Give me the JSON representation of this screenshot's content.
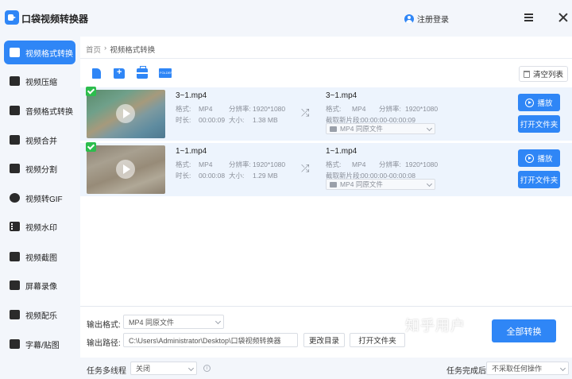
{
  "app": {
    "title": "口袋视频转换器",
    "login": "注册登录"
  },
  "sidebar": {
    "items": [
      {
        "label": "视频格式转换",
        "icon": "video-convert-icon",
        "active": true
      },
      {
        "label": "视频压缩",
        "icon": "video-compress-icon"
      },
      {
        "label": "音频格式转换",
        "icon": "audio-convert-icon"
      },
      {
        "label": "视频合并",
        "icon": "video-merge-icon"
      },
      {
        "label": "视频分割",
        "icon": "video-split-icon"
      },
      {
        "label": "视频转GIF",
        "icon": "gif-icon"
      },
      {
        "label": "视频水印",
        "icon": "watermark-icon"
      },
      {
        "label": "视频截图",
        "icon": "screenshot-icon"
      },
      {
        "label": "屏幕录像",
        "icon": "screen-record-icon"
      },
      {
        "label": "视频配乐",
        "icon": "music-icon"
      },
      {
        "label": "字幕/贴图",
        "icon": "subtitle-icon"
      }
    ]
  },
  "breadcrumb": {
    "home": "首页",
    "sep": "›",
    "current": "视频格式转换"
  },
  "toolbar": {
    "icons": [
      "add-file-icon",
      "add-folder-icon",
      "batch-icon",
      "folder-import-icon"
    ],
    "clear_label": "清空列表"
  },
  "labels": {
    "format": "格式:",
    "resolution": "分辨率:",
    "duration": "时长:",
    "size": "大小:",
    "clip": "截取新片段:",
    "play": "播放",
    "open_folder": "打开文件夹"
  },
  "files": [
    {
      "name": "3~1.mp4",
      "format": "MP4",
      "resolution": "1920*1080",
      "duration": "00:00:09",
      "size": "1.38 MB",
      "out_name": "3~1.mp4",
      "out_format": "MP4",
      "out_resolution": "1920*1080",
      "clip": "00:00:00-00:00:09",
      "out_select": "MP4  同原文件"
    },
    {
      "name": "1~1.mp4",
      "format": "MP4",
      "resolution": "1920*1080",
      "duration": "00:00:08",
      "size": "1.29 MB",
      "out_name": "1~1.mp4",
      "out_format": "MP4",
      "out_resolution": "1920*1080",
      "clip": "00:00:00-00:00:08",
      "out_select": "MP4  同原文件"
    }
  ],
  "bottom": {
    "output_format_label": "输出格式:",
    "output_format_value": "MP4  同原文件",
    "output_path_label": "输出路径:",
    "output_path_value": "C:\\Users\\Administrator\\Desktop\\口袋视频转换器",
    "change_dir": "更改目录",
    "open_folder": "打开文件夹",
    "convert_all": "全部转换",
    "multithread_label": "任务多线程",
    "multithread_value": "关闭",
    "after_label": "任务完成后",
    "after_value": "不采取任何操作"
  },
  "watermark": "知乎用户",
  "colors": {
    "accent": "#2f86f6",
    "sidebar_bg": "#f3f6fb",
    "row_bg": "#edf4fd",
    "check": "#2cbd4d"
  }
}
